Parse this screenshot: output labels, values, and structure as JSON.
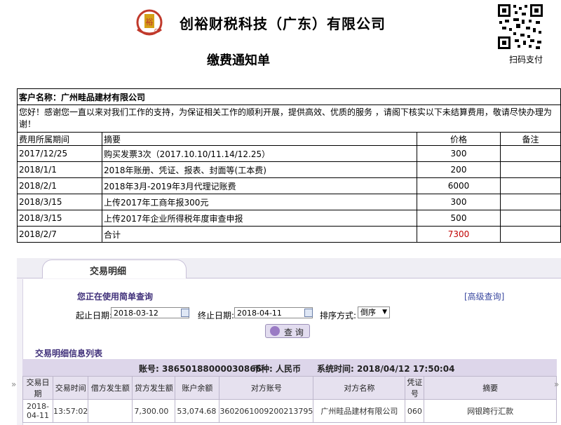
{
  "header": {
    "logo_icon": "company-logo-icon",
    "company_name": "创裕财税科技（广东）有限公司",
    "doc_title": "缴费通知单",
    "qr_label": "扫码支付"
  },
  "notice": {
    "customer_label": "客户名称：广州畦品建材有限公司",
    "greeting": "您好！感谢您一直以来对我们工作的支持，为保证相关工作的顺利开展，提供高效、优质的服务 ，请阁下核实以下未结算费用，敬请尽快办理为谢！",
    "columns": [
      "费用所属期间",
      "摘要",
      "价格",
      "备注"
    ],
    "rows": [
      {
        "period": "2017/12/25",
        "summary": "购买发票3次（2017.10.10/11.14/12.25）",
        "price": "300",
        "note": ""
      },
      {
        "period": "2018/1/1",
        "summary": "2018年账册、凭证、报表、封面等(工本费)",
        "price": "200",
        "note": ""
      },
      {
        "period": "2018/2/1",
        "summary": "2018年3月-2019年3月代理记账费",
        "price": "6000",
        "note": ""
      },
      {
        "period": "2018/3/15",
        "summary": "上传2017年工商年报300元",
        "price": "300",
        "note": ""
      },
      {
        "period": "2018/3/15",
        "summary": "上传2017年企业所得税年度审查申报",
        "price": "500",
        "note": ""
      }
    ],
    "total": {
      "period": "2018/2/7",
      "summary": "合计",
      "price": "7300",
      "note": ""
    },
    "total_color": "#c00000"
  },
  "transactions": {
    "tab_label": "交易明细",
    "simple_query": "您正在使用简单查询",
    "advanced_query": "[高级查询]",
    "start_label": "起止日期:",
    "start_value": "2018-03-12",
    "end_label": "终止日期:",
    "end_value": "2018-04-11",
    "sort_label": "排序方式:",
    "sort_value": "倒序",
    "query_button": "查 询",
    "list_title": "交易明细信息列表",
    "account": "账号: 38650188000030866",
    "currency": "币种: 人民币",
    "system_time": "系统时间: 2018/04/12 17:50:04",
    "side_arrow": "»",
    "columns": [
      "交易日期",
      "交易时间",
      "借方发生额",
      "贷方发生额",
      "账户余额",
      "对方账号",
      "对方名称",
      "凭证号",
      "摘要"
    ],
    "rows": [
      {
        "date": "2018-04-11",
        "time": "13:57:02",
        "debit": "",
        "credit": "7,300.00",
        "balance": "53,074.68",
        "counter_account": "3602061009200213795",
        "counter_name": "广州畦品建材有限公司",
        "voucher": "060",
        "summary": "网银跨行汇款"
      }
    ]
  }
}
